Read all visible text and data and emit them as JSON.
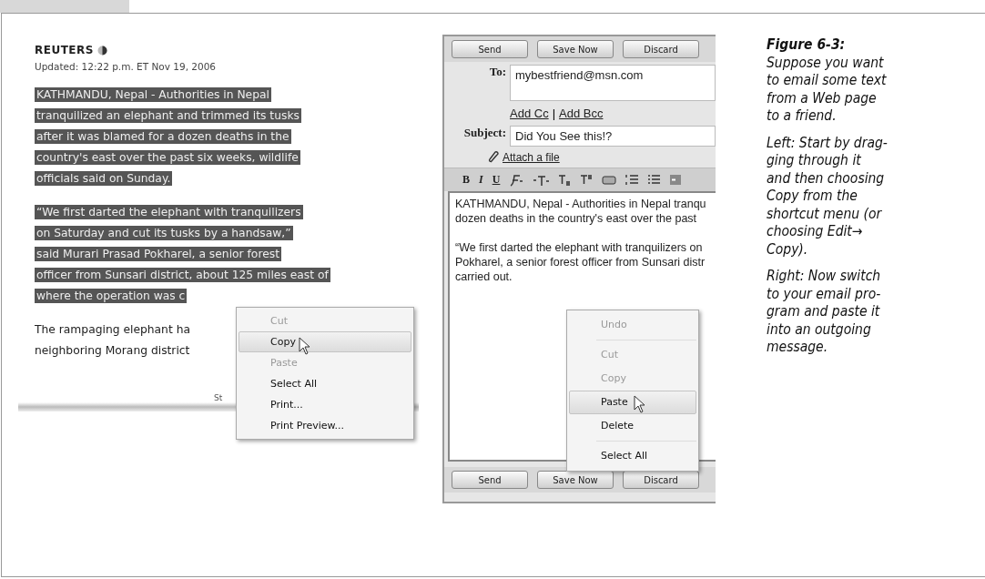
{
  "web_page": {
    "source": "REUTERS",
    "updated": "Updated: 12:22 p.m. ET Nov 19, 2006",
    "paragraphs": [
      {
        "selected": true,
        "lines": [
          "KATHMANDU, Nepal - Authorities in Nepal",
          "tranquilized an elephant and trimmed its tusks",
          "after it was blamed for a dozen deaths in the",
          "country's east over the past six weeks, wildlife",
          "officials said on Sunday."
        ]
      },
      {
        "selected": true,
        "lines": [
          "“We first darted the elephant with tranquilizers",
          "on Saturday and cut its tusks by a handsaw,”",
          "said Murari Prasad Pokharel, a senior forest",
          "officer from Sunsari district, about 125 miles east of",
          "where the operation was c"
        ]
      },
      {
        "selected": false,
        "lines": [
          "The rampaging elephant ha",
          "neighboring Morang district"
        ]
      }
    ],
    "footer_fragment": "St",
    "context_menu": [
      {
        "label": "Cut",
        "disabled": true,
        "selected": false
      },
      {
        "label": "Copy",
        "disabled": false,
        "selected": true
      },
      {
        "label": "Paste",
        "disabled": true,
        "selected": false
      },
      {
        "label": "Select All",
        "disabled": false,
        "selected": false
      },
      {
        "label": "Print...",
        "disabled": false,
        "selected": false
      },
      {
        "label": "Print Preview...",
        "disabled": false,
        "selected": false
      }
    ]
  },
  "email": {
    "top_buttons": [
      "Send",
      "Save Now",
      "Discard"
    ],
    "to_label": "To:",
    "to_value": "mybestfriend@msn.com",
    "add_cc": "Add Cc",
    "separator": "|",
    "add_bcc": "Add Bcc",
    "subject_label": "Subject:",
    "subject_value": "Did You See this!?",
    "attach": "Attach a file",
    "format_buttons": [
      "B",
      "I",
      "U"
    ],
    "body": [
      [
        "KATHMANDU, Nepal - Authorities in Nepal tranqu",
        "dozen deaths in the country's east over the past"
      ],
      [
        "“We first darted the elephant with tranquilizers on",
        "Pokharel, a senior forest officer from Sunsari distr",
        "carried out."
      ]
    ],
    "context_menu": [
      {
        "label": "Undo",
        "disabled": true,
        "selected": false,
        "separator_after": true
      },
      {
        "label": "Cut",
        "disabled": true,
        "selected": false,
        "separator_after": false
      },
      {
        "label": "Copy",
        "disabled": true,
        "selected": false,
        "separator_after": false
      },
      {
        "label": "Paste",
        "disabled": false,
        "selected": true,
        "separator_after": false
      },
      {
        "label": "Delete",
        "disabled": false,
        "selected": false,
        "separator_after": true
      },
      {
        "label": "Select All",
        "disabled": false,
        "selected": false,
        "separator_after": false
      }
    ],
    "bottom_buttons": [
      "Send",
      "Save Now",
      "Discard"
    ]
  },
  "caption": {
    "title": "Figure 6-3:",
    "paragraphs": [
      [
        "Suppose you want",
        "to email some text",
        "from a Web page",
        "to a friend."
      ],
      [
        "Left: Start by drag-",
        "ging through it",
        "and then choosing",
        "Copy from the",
        "shortcut menu (or",
        "choosing Edit→",
        "Copy)."
      ],
      [
        "Right: Now switch",
        "to your email pro-",
        "gram and paste it",
        "into an outgoing",
        "message."
      ]
    ]
  }
}
